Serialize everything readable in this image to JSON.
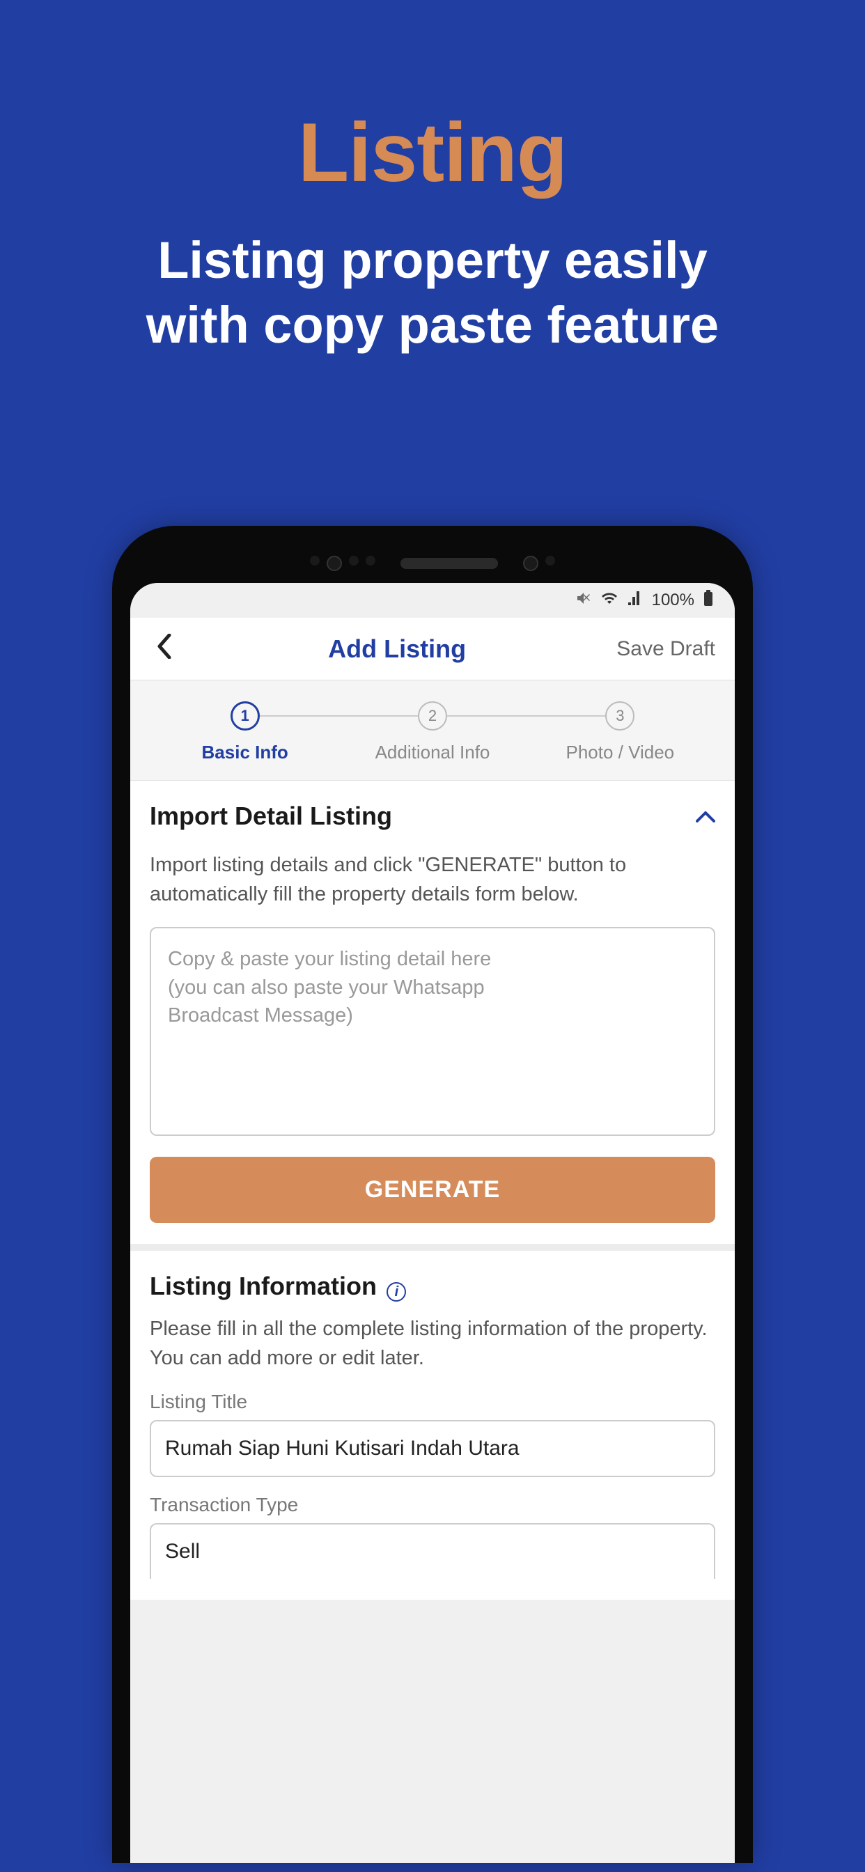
{
  "promo": {
    "title": "Listing",
    "subtitle_line1": "Listing property easily",
    "subtitle_line2": "with copy paste feature"
  },
  "status_bar": {
    "battery_text": "100%"
  },
  "header": {
    "title": "Add Listing",
    "save_draft": "Save Draft"
  },
  "stepper": {
    "steps": [
      {
        "num": "1",
        "label": "Basic Info",
        "active": true
      },
      {
        "num": "2",
        "label": "Additional Info",
        "active": false
      },
      {
        "num": "3",
        "label": "Photo / Video",
        "active": false
      }
    ]
  },
  "import_card": {
    "title": "Import Detail Listing",
    "description": "Import listing details and click \"GENERATE\" button to automatically fill the property details form below.",
    "placeholder_line1": "Copy & paste your listing detail here",
    "placeholder_line2": "(you can also paste your Whatsapp",
    "placeholder_line3": "Broadcast Message)",
    "generate_label": "GENERATE"
  },
  "listing_info_card": {
    "title": "Listing Information",
    "description": "Please fill in all the complete listing information of the property. You can add more or edit later.",
    "fields": {
      "title_label": "Listing Title",
      "title_value": "Rumah Siap Huni Kutisari Indah Utara",
      "transaction_label": "Transaction Type",
      "transaction_value": "Sell"
    }
  }
}
